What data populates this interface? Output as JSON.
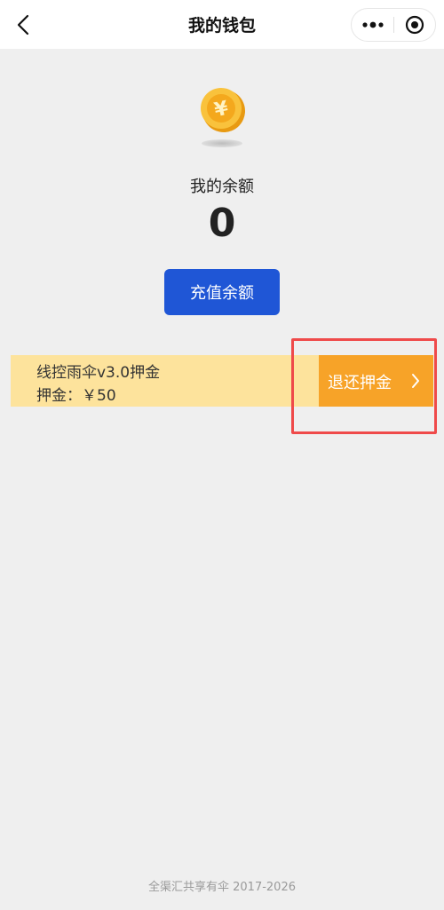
{
  "navbar": {
    "title": "我的钱包",
    "back_icon": "chevron-left-icon",
    "more_icon": "more-dots-icon",
    "close_icon": "target-circle-icon"
  },
  "wallet": {
    "coin_icon": "yen-coin-icon",
    "balance_label": "我的余额",
    "balance_value": "0",
    "recharge_label": "充值余额"
  },
  "deposit": {
    "item_name": "线控雨伞v3.0押金",
    "amount_text": "押金：￥50",
    "refund_label": "退还押金",
    "refund_icon": "chevron-right-icon"
  },
  "footer": {
    "text": "全渠汇共享有伞 2017-2026"
  },
  "colors": {
    "primary_button": "#1f56d6",
    "deposit_card_bg": "#fde39c",
    "refund_button": "#f7a328",
    "highlight_border": "#ef4a4a",
    "page_bg": "#efefef"
  }
}
